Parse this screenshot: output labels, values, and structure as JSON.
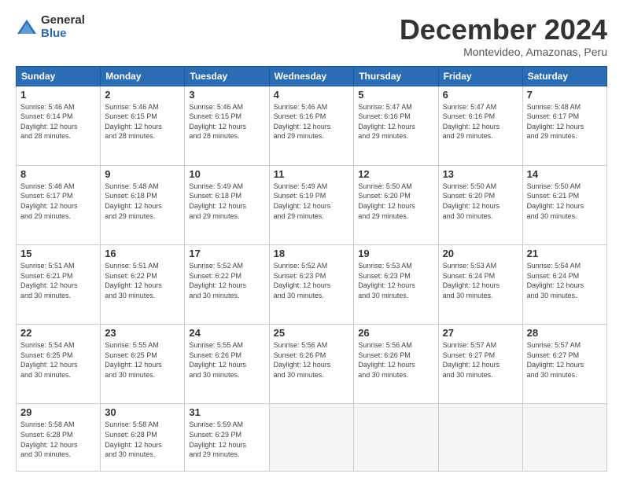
{
  "logo": {
    "general": "General",
    "blue": "Blue"
  },
  "title": "December 2024",
  "subtitle": "Montevideo, Amazonas, Peru",
  "headers": [
    "Sunday",
    "Monday",
    "Tuesday",
    "Wednesday",
    "Thursday",
    "Friday",
    "Saturday"
  ],
  "weeks": [
    [
      {
        "day": "1",
        "info": "Sunrise: 5:46 AM\nSunset: 6:14 PM\nDaylight: 12 hours\nand 28 minutes."
      },
      {
        "day": "2",
        "info": "Sunrise: 5:46 AM\nSunset: 6:15 PM\nDaylight: 12 hours\nand 28 minutes."
      },
      {
        "day": "3",
        "info": "Sunrise: 5:46 AM\nSunset: 6:15 PM\nDaylight: 12 hours\nand 28 minutes."
      },
      {
        "day": "4",
        "info": "Sunrise: 5:46 AM\nSunset: 6:16 PM\nDaylight: 12 hours\nand 29 minutes."
      },
      {
        "day": "5",
        "info": "Sunrise: 5:47 AM\nSunset: 6:16 PM\nDaylight: 12 hours\nand 29 minutes."
      },
      {
        "day": "6",
        "info": "Sunrise: 5:47 AM\nSunset: 6:16 PM\nDaylight: 12 hours\nand 29 minutes."
      },
      {
        "day": "7",
        "info": "Sunrise: 5:48 AM\nSunset: 6:17 PM\nDaylight: 12 hours\nand 29 minutes."
      }
    ],
    [
      {
        "day": "8",
        "info": "Sunrise: 5:48 AM\nSunset: 6:17 PM\nDaylight: 12 hours\nand 29 minutes."
      },
      {
        "day": "9",
        "info": "Sunrise: 5:48 AM\nSunset: 6:18 PM\nDaylight: 12 hours\nand 29 minutes."
      },
      {
        "day": "10",
        "info": "Sunrise: 5:49 AM\nSunset: 6:18 PM\nDaylight: 12 hours\nand 29 minutes."
      },
      {
        "day": "11",
        "info": "Sunrise: 5:49 AM\nSunset: 6:19 PM\nDaylight: 12 hours\nand 29 minutes."
      },
      {
        "day": "12",
        "info": "Sunrise: 5:50 AM\nSunset: 6:20 PM\nDaylight: 12 hours\nand 29 minutes."
      },
      {
        "day": "13",
        "info": "Sunrise: 5:50 AM\nSunset: 6:20 PM\nDaylight: 12 hours\nand 30 minutes."
      },
      {
        "day": "14",
        "info": "Sunrise: 5:50 AM\nSunset: 6:21 PM\nDaylight: 12 hours\nand 30 minutes."
      }
    ],
    [
      {
        "day": "15",
        "info": "Sunrise: 5:51 AM\nSunset: 6:21 PM\nDaylight: 12 hours\nand 30 minutes."
      },
      {
        "day": "16",
        "info": "Sunrise: 5:51 AM\nSunset: 6:22 PM\nDaylight: 12 hours\nand 30 minutes."
      },
      {
        "day": "17",
        "info": "Sunrise: 5:52 AM\nSunset: 6:22 PM\nDaylight: 12 hours\nand 30 minutes."
      },
      {
        "day": "18",
        "info": "Sunrise: 5:52 AM\nSunset: 6:23 PM\nDaylight: 12 hours\nand 30 minutes."
      },
      {
        "day": "19",
        "info": "Sunrise: 5:53 AM\nSunset: 6:23 PM\nDaylight: 12 hours\nand 30 minutes."
      },
      {
        "day": "20",
        "info": "Sunrise: 5:53 AM\nSunset: 6:24 PM\nDaylight: 12 hours\nand 30 minutes."
      },
      {
        "day": "21",
        "info": "Sunrise: 5:54 AM\nSunset: 6:24 PM\nDaylight: 12 hours\nand 30 minutes."
      }
    ],
    [
      {
        "day": "22",
        "info": "Sunrise: 5:54 AM\nSunset: 6:25 PM\nDaylight: 12 hours\nand 30 minutes."
      },
      {
        "day": "23",
        "info": "Sunrise: 5:55 AM\nSunset: 6:25 PM\nDaylight: 12 hours\nand 30 minutes."
      },
      {
        "day": "24",
        "info": "Sunrise: 5:55 AM\nSunset: 6:26 PM\nDaylight: 12 hours\nand 30 minutes."
      },
      {
        "day": "25",
        "info": "Sunrise: 5:56 AM\nSunset: 6:26 PM\nDaylight: 12 hours\nand 30 minutes."
      },
      {
        "day": "26",
        "info": "Sunrise: 5:56 AM\nSunset: 6:26 PM\nDaylight: 12 hours\nand 30 minutes."
      },
      {
        "day": "27",
        "info": "Sunrise: 5:57 AM\nSunset: 6:27 PM\nDaylight: 12 hours\nand 30 minutes."
      },
      {
        "day": "28",
        "info": "Sunrise: 5:57 AM\nSunset: 6:27 PM\nDaylight: 12 hours\nand 30 minutes."
      }
    ],
    [
      {
        "day": "29",
        "info": "Sunrise: 5:58 AM\nSunset: 6:28 PM\nDaylight: 12 hours\nand 30 minutes."
      },
      {
        "day": "30",
        "info": "Sunrise: 5:58 AM\nSunset: 6:28 PM\nDaylight: 12 hours\nand 30 minutes."
      },
      {
        "day": "31",
        "info": "Sunrise: 5:59 AM\nSunset: 6:29 PM\nDaylight: 12 hours\nand 29 minutes."
      },
      {
        "day": "",
        "info": ""
      },
      {
        "day": "",
        "info": ""
      },
      {
        "day": "",
        "info": ""
      },
      {
        "day": "",
        "info": ""
      }
    ]
  ]
}
